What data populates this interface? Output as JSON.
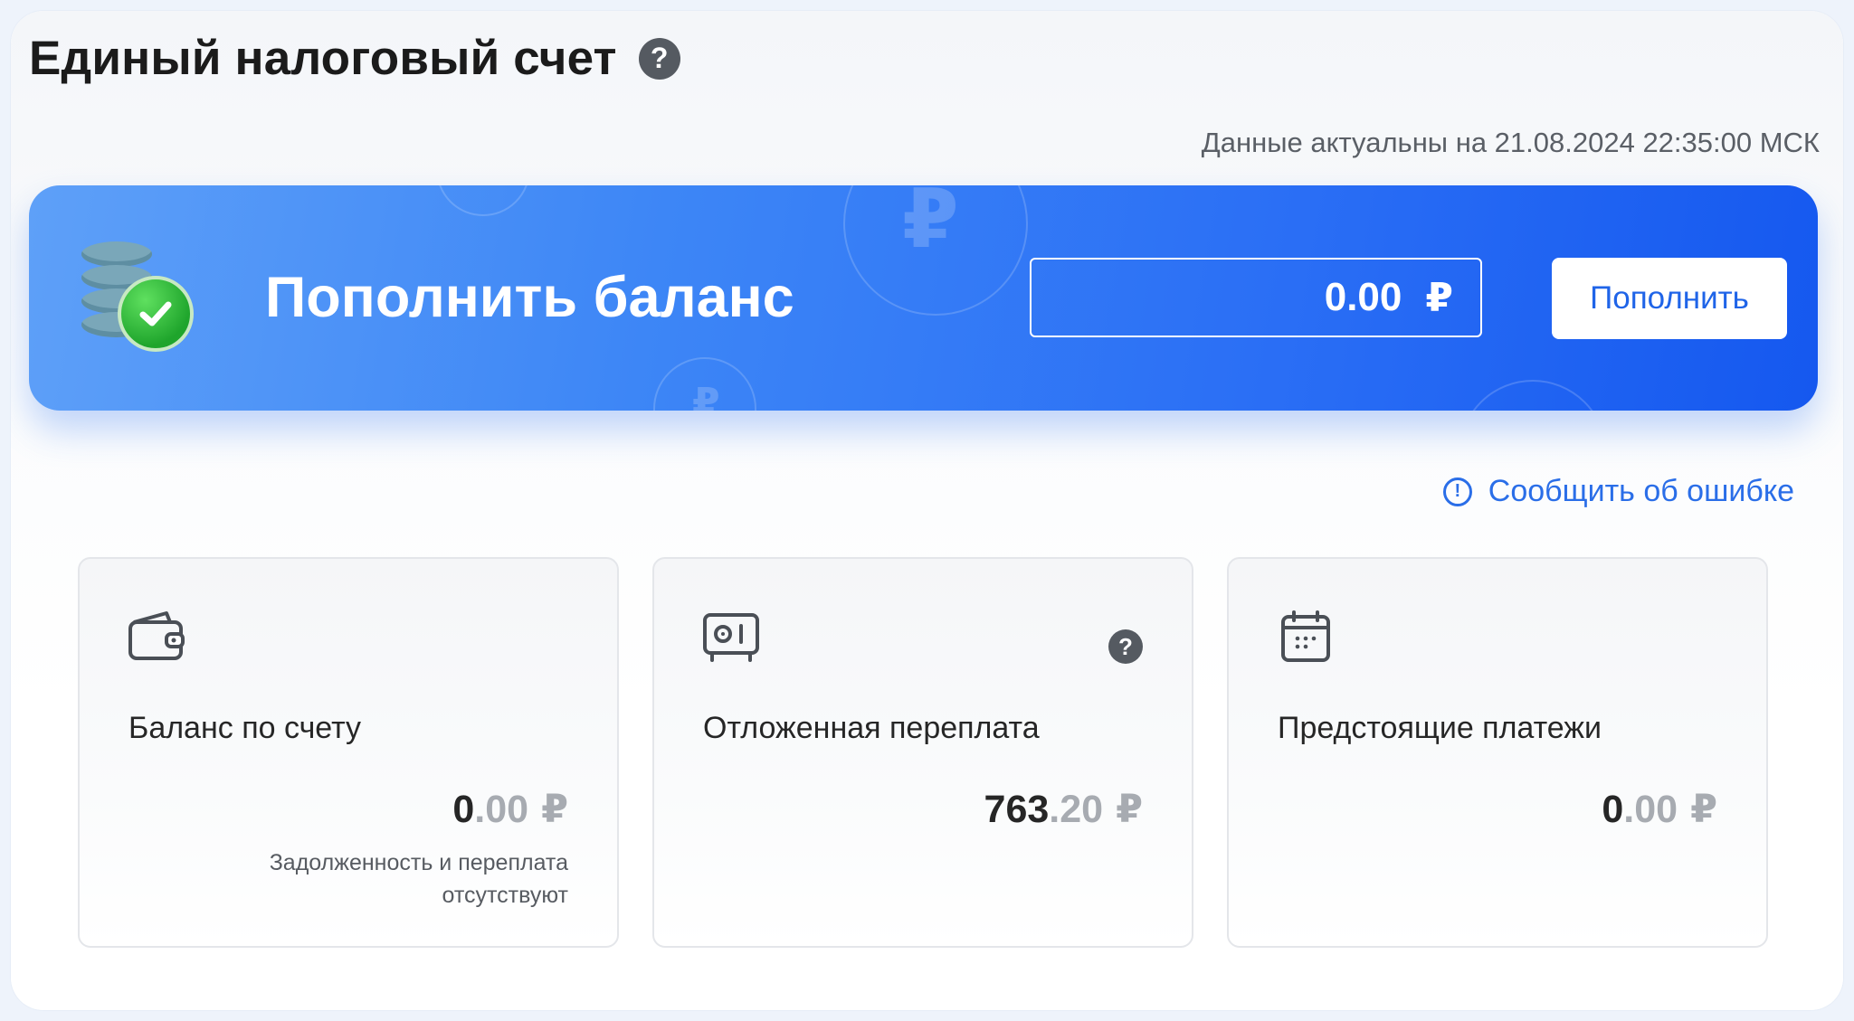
{
  "header": {
    "title": "Единый налоговый счет",
    "help_symbol": "?",
    "updated": "Данные актуальны на 21.08.2024 22:35:00 МСК"
  },
  "banner": {
    "title": "Пополнить баланс",
    "amount": "0.00",
    "currency": "₽",
    "button_label": "Пополнить",
    "coin_icon": "coin-stack-check-icon"
  },
  "report": {
    "label": "Сообщить об ошибке",
    "icon": "info-circle-icon"
  },
  "cards": [
    {
      "icon": "wallet-icon",
      "label": "Баланс по счету",
      "amount_int": "0",
      "amount_frac": ".00",
      "currency": "₽",
      "note": "Задолженность и переплата отсутствуют"
    },
    {
      "icon": "safe-icon",
      "label": "Отложенная переплата",
      "amount_int": "763",
      "amount_frac": ".20",
      "currency": "₽",
      "help_symbol": "?"
    },
    {
      "icon": "calendar-icon",
      "label": "Предстоящие платежи",
      "amount_int": "0",
      "amount_frac": ".00",
      "currency": "₽"
    }
  ],
  "colors": {
    "banner_start": "#5ea0f8",
    "banner_end": "#1558ef",
    "link": "#2a6ee8",
    "check": "#1fa52c"
  }
}
